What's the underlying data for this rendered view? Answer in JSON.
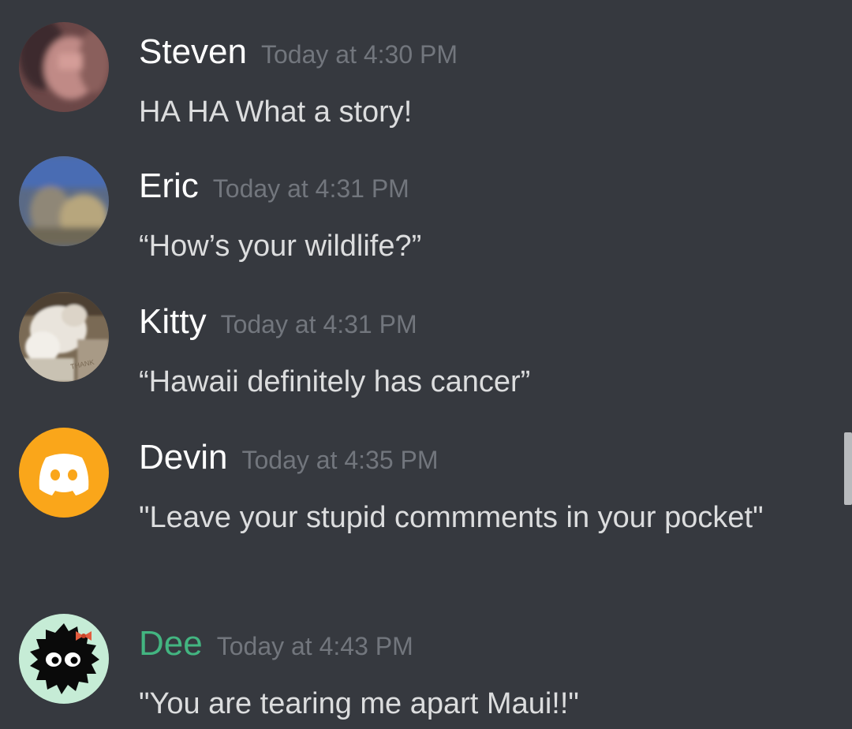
{
  "messages": [
    {
      "username": "Steven",
      "timestamp": "Today at 4:30 PM",
      "text": "HA HA What a story!",
      "avatar": "blurred-photo-avatar"
    },
    {
      "username": "Eric",
      "timestamp": "Today at 4:31 PM",
      "text": "“How’s your wildlife?”",
      "avatar": "blurred-photo-avatar"
    },
    {
      "username": "Kitty",
      "timestamp": "Today at 4:31 PM",
      "text": "“Hawaii definitely has cancer”",
      "avatar": "cat-photo-avatar",
      "avatar_text": "THANK"
    },
    {
      "username": "Devin",
      "timestamp": "Today at 4:35 PM",
      "text": "\"Leave your stupid commments in your pocket\"",
      "avatar": "discord-default-avatar"
    },
    {
      "username": "Dee",
      "timestamp": "Today at 4:43 PM",
      "text": "\"You are tearing me apart Maui!!\"",
      "avatar": "soot-sprite-avatar"
    }
  ],
  "colors": {
    "background": "#36393f",
    "username_default": "#ffffff",
    "username_dee": "#43b581",
    "timestamp": "#72767d",
    "message_text": "#dcddde",
    "devin_avatar_bg": "#faa61a",
    "dee_avatar_bg": "#c6ecd6",
    "scrollbar_thumb": "#b9bbbe"
  }
}
